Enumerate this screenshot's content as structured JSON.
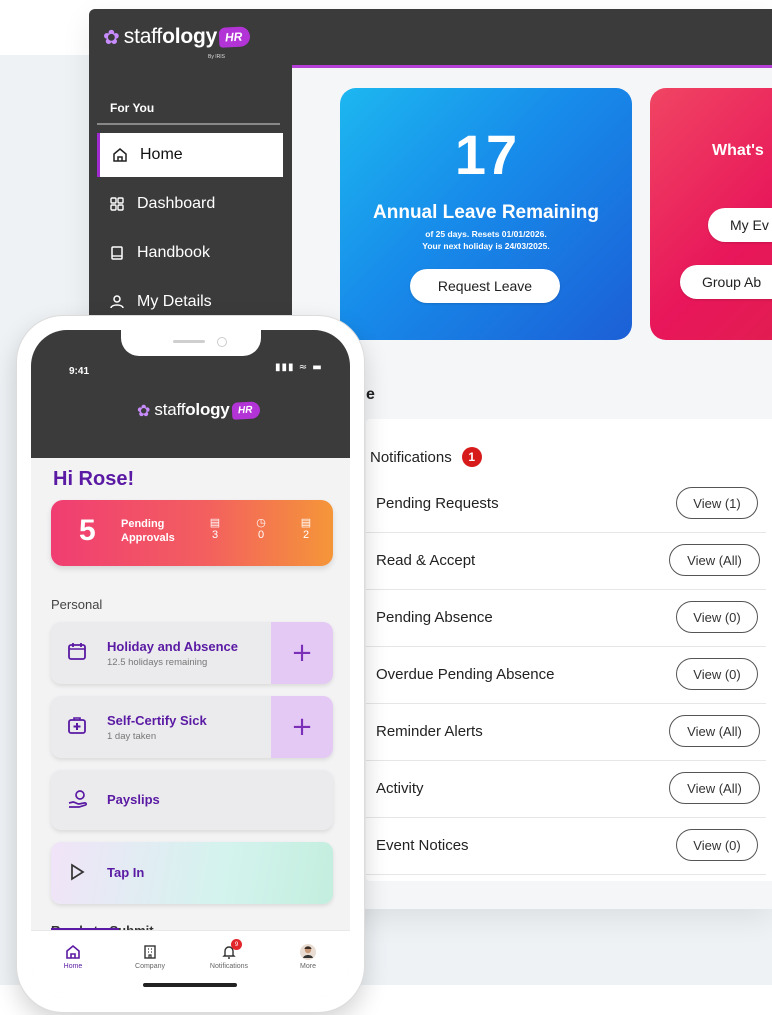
{
  "brand": {
    "name_light": "staff",
    "name_bold": "ology",
    "tag": "HR",
    "byline": "By IRIS"
  },
  "colors": {
    "accent": "#5a1aa3",
    "leave_card": "#178bea",
    "event_card": "#e8165a",
    "sidebar": "#3b3b3b",
    "badge_red": "#d71b1b"
  },
  "desktop": {
    "sidebar": {
      "section_title": "For You",
      "items": [
        {
          "label": "Home",
          "icon": "home-icon",
          "active": true
        },
        {
          "label": "Dashboard",
          "icon": "grid-icon",
          "active": false
        },
        {
          "label": "Handbook",
          "icon": "book-icon",
          "active": false
        },
        {
          "label": "My Details",
          "icon": "person-icon",
          "active": false
        }
      ]
    },
    "leave_card": {
      "days": "17",
      "title": "Annual Leave Remaining",
      "line1": "of 25 days. Resets 01/01/2026.",
      "line2": "Your next holiday is 24/03/2025.",
      "button": "Request Leave"
    },
    "event_card": {
      "title": "What's",
      "button1": "My Ev",
      "button2": "Group Ab"
    },
    "section_title_fragment": "e",
    "notifications": {
      "title": "Notifications",
      "badge": "1",
      "rows": [
        {
          "label": "Pending Requests",
          "button": "View (1)"
        },
        {
          "label": "Read & Accept",
          "button": "View (All)"
        },
        {
          "label": "Pending Absence",
          "button": "View (0)"
        },
        {
          "label": "Overdue Pending Absence",
          "button": "View (0)"
        },
        {
          "label": "Reminder Alerts",
          "button": "View (All)"
        },
        {
          "label": "Activity",
          "button": "View (All)"
        },
        {
          "label": "Event Notices",
          "button": "View (0)"
        }
      ]
    }
  },
  "phone": {
    "status_time": "9:41",
    "greeting": "Hi Rose!",
    "pending": {
      "count": "5",
      "label1": "Pending",
      "label2": "Approvals",
      "stats": [
        "3",
        "0",
        "2"
      ]
    },
    "personal_label": "Personal",
    "tiles": [
      {
        "title": "Holiday and Absence",
        "subtitle": "12.5 holidays remaining",
        "icon": "calendar-icon"
      },
      {
        "title": "Self-Certify Sick",
        "subtitle": "1 day taken",
        "icon": "medical-bag-icon"
      },
      {
        "title": "Payslips",
        "icon": "payslip-hand-icon"
      },
      {
        "title": "Tap In",
        "icon": "play-icon"
      }
    ],
    "ready_label": "Ready to Submit",
    "nav": [
      {
        "label": "Home",
        "icon": "home-icon"
      },
      {
        "label": "Company",
        "icon": "building-icon"
      },
      {
        "label": "Notifications",
        "icon": "bell-icon",
        "badge": "9"
      },
      {
        "label": "More",
        "icon": "avatar"
      }
    ]
  }
}
